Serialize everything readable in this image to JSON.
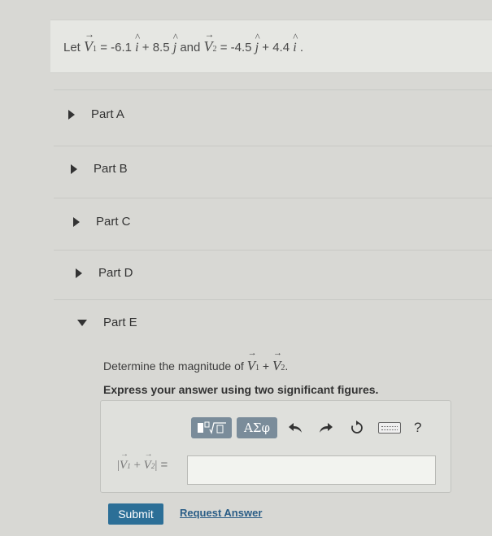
{
  "problem": {
    "let": "Let",
    "v1_symbol": "V",
    "v1_sub": "1",
    "v1_expr_a": " = -6.1 ",
    "unit_i": "i",
    "v1_expr_b": " + 8.5 ",
    "unit_j": "j",
    "and": " and ",
    "v2_symbol": "V",
    "v2_sub": "2",
    "v2_expr_a": " = -4.5 ",
    "v2_expr_b": " + 4.4 ",
    "end": " ."
  },
  "parts": [
    {
      "label": "Part A",
      "expanded": false
    },
    {
      "label": "Part B",
      "expanded": false
    },
    {
      "label": "Part C",
      "expanded": false
    },
    {
      "label": "Part D",
      "expanded": false
    },
    {
      "label": "Part E",
      "expanded": true
    }
  ],
  "part_e": {
    "question_prefix": "Determine the magnitude of ",
    "v_symbol": "V",
    "sub1": "1",
    "plus": " + ",
    "sub2": "2",
    "question_suffix": ".",
    "instruction": "Express your answer using two significant figures.",
    "toolbar": {
      "template_icon": "template-sqrt-icon",
      "greek_label": "ΑΣφ",
      "undo_icon": "undo-icon",
      "redo_icon": "redo-icon",
      "reset_icon": "reset-icon",
      "keyboard_icon": "keyboard-icon",
      "help_label": "?"
    },
    "answer_label": {
      "bar_left": "|",
      "v": "V",
      "sub1": "1",
      "plus": " + ",
      "sub2": "2",
      "bar_right": "|",
      "equals": " ="
    },
    "answer_value": "",
    "submit_label": "Submit",
    "request_answer_label": "Request Answer"
  }
}
